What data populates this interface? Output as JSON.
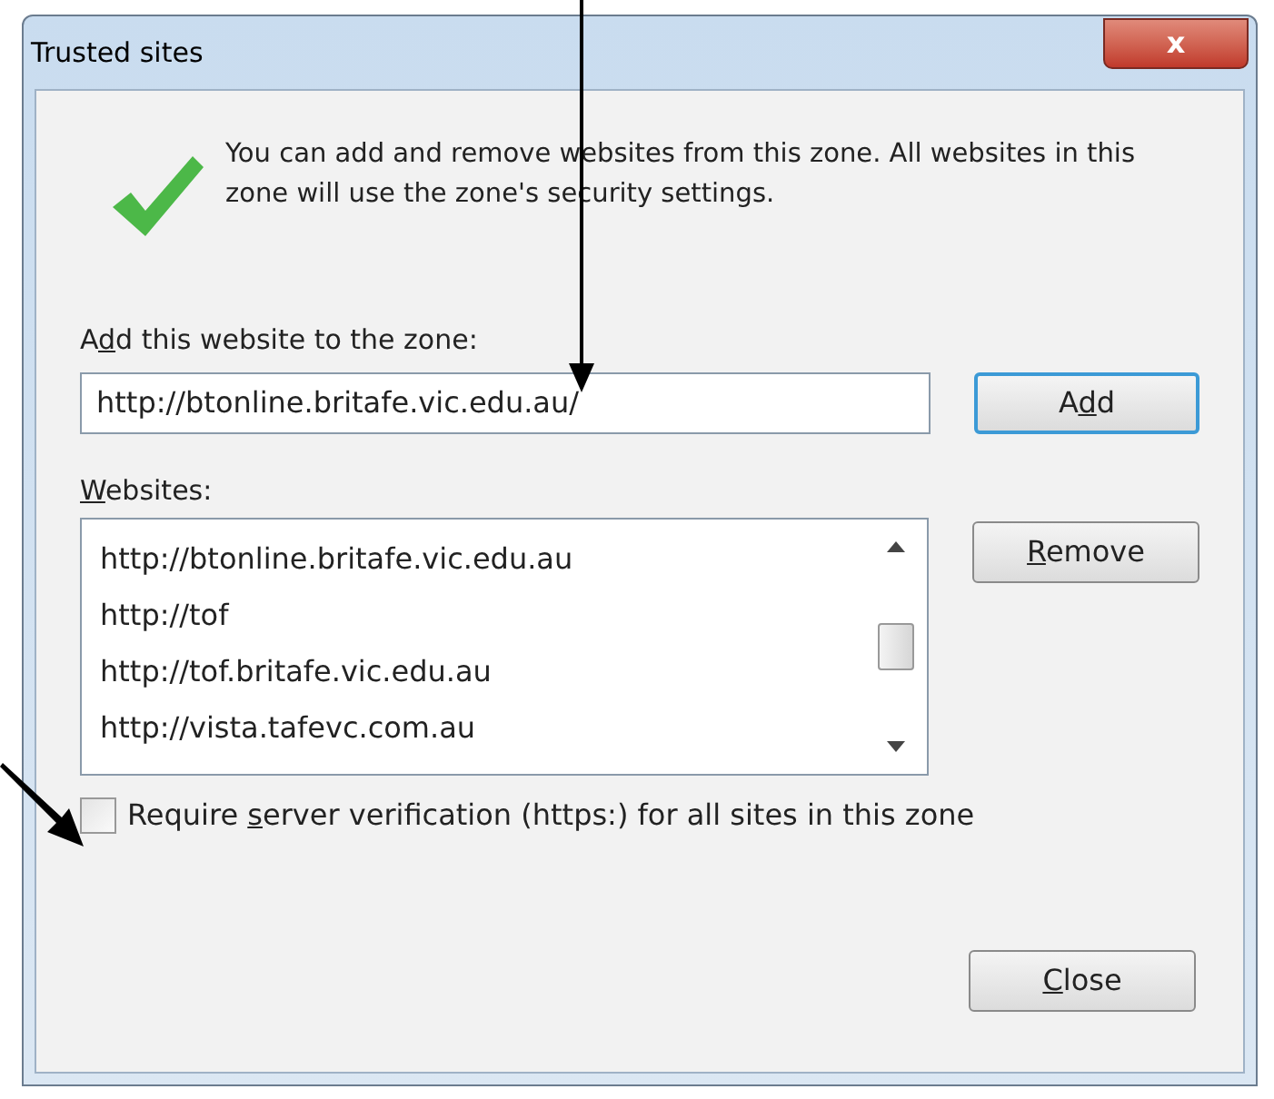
{
  "window": {
    "title": "Trusted sites",
    "close_glyph": "x"
  },
  "info": {
    "text": "You can add and remove websites from this zone. All websites in this zone will use the zone's security settings."
  },
  "add_field": {
    "label": {
      "before": "A",
      "key": "d",
      "after": "d this website to the zone:"
    },
    "value": "http://btonline.britafe.vic.edu.au/"
  },
  "add_button": {
    "before": "A",
    "key": "d",
    "after": "d",
    "focused": true
  },
  "websites": {
    "label": {
      "key": "W",
      "after": "ebsites:"
    },
    "items": [
      {
        "text": "http://btonline.britafe.vic.edu.au"
      },
      {
        "text": "http://tof"
      },
      {
        "text": "http://tof.britafe.vic.edu.au"
      },
      {
        "text": "http://vista.tafevc.com.au"
      }
    ]
  },
  "remove_button": {
    "key": "R",
    "after": "emove"
  },
  "require_https": {
    "label": {
      "before": "Require ",
      "key": "s",
      "after": "erver verification (https:) for all sites in this zone"
    },
    "checked": false
  },
  "close_button": {
    "key": "C",
    "after": "lose"
  }
}
